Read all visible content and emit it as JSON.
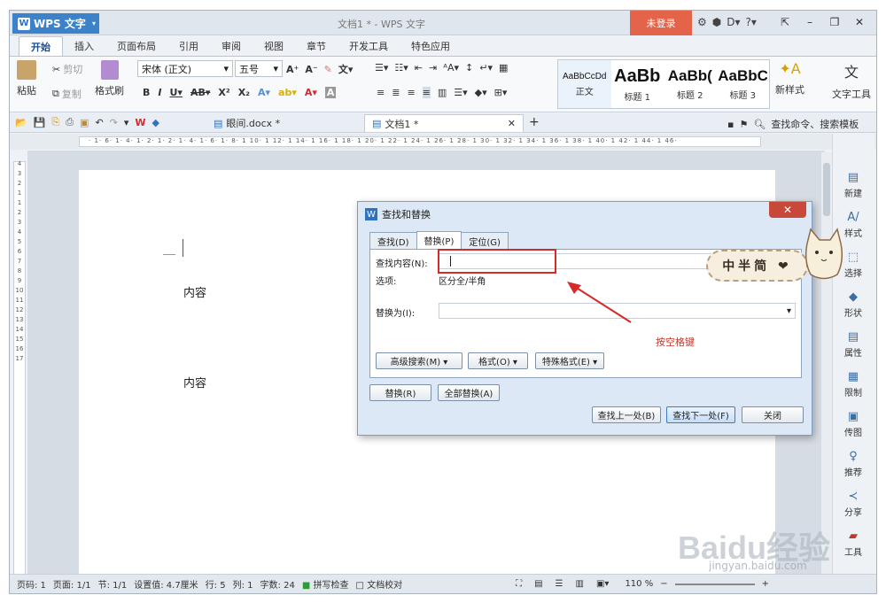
{
  "app": {
    "name": "WPS 文字",
    "title": "文档1 * - WPS 文字",
    "login": "未登录"
  },
  "menu_tabs": [
    "开始",
    "插入",
    "页面布局",
    "引用",
    "审阅",
    "视图",
    "章节",
    "开发工具",
    "特色应用"
  ],
  "ribbon": {
    "paste": "粘贴",
    "cut": "剪切",
    "copy": "复制",
    "format_painter": "格式刷",
    "font": "宋体 (正文)",
    "size": "五号",
    "styles": [
      {
        "sample": "AaBbCcDd",
        "name": "正文"
      },
      {
        "sample": "AaBb",
        "name": "标题 1"
      },
      {
        "sample": "AaBb(",
        "name": "标题 2"
      },
      {
        "sample": "AaBbC",
        "name": "标题 3"
      }
    ],
    "new_style": "新样式",
    "text_tool": "文字工具"
  },
  "doc_tabs": [
    {
      "label": "眼间.docx *"
    },
    {
      "label": "文档1 *"
    }
  ],
  "search_box": "查找命令、搜索模板",
  "ruler_marks": "· 1· 6· 1· 4· 1· 2· 1· 2· 1· 4· 1· 6· 1· 8· 1 10· 1 12· 1 14· 1 16· 1 18· 1 20· 1 22· 1 24· 1 26· 1 28· 1 30· 1 32· 1 34· 1 36· 1 38· 1 40· 1 42· 1 44· 1 46·",
  "vruler_marks": "4\n\n3\n\n2\n\n1\n\n1\n\n2\n\n3\n\n4\n\n5\n\n6\n\n7\n\n8\n\n9\n\n10\n\n11\n\n12\n\n13\n\n14\n\n15\n\n16\n\n17",
  "document": {
    "line1": "内容",
    "line2": "内容"
  },
  "dialog": {
    "title": "查找和替换",
    "tabs": [
      "查找(D)",
      "替换(P)",
      "定位(G)"
    ],
    "find_label": "查找内容(N):",
    "options_label": "选项:",
    "options_value": "区分全/半角",
    "replace_label": "替换为(I):",
    "advanced": "高级搜索(M) ▾",
    "format": "格式(O) ▾",
    "special": "特殊格式(E) ▾",
    "replace": "替换(R)",
    "replace_all": "全部替换(A)",
    "find_prev": "查找上一处(B)",
    "find_next": "查找下一处(F)",
    "close": "关闭"
  },
  "annotation": "按空格键",
  "badge": "中半简 ❤",
  "sidebar": [
    "新建",
    "样式",
    "选择",
    "形状",
    "属性",
    "限制",
    "传图",
    "推荐",
    "分享",
    "工具"
  ],
  "status": {
    "page_num": "页码: 1",
    "pages": "页面: 1/1",
    "section": "节: 1/1",
    "setting": "设置值: 4.7厘米",
    "row": "行: 5",
    "col": "列: 1",
    "words": "字数: 24",
    "spell": "拼写检查",
    "proof": "文档校对",
    "zoom": "110 %"
  },
  "watermark": "Baidu经验",
  "watermark_sub": "jingyan.baidu.com",
  "colors": {
    "accent": "#3b82c9",
    "login": "#e4644a",
    "annot": "#c0392b"
  }
}
